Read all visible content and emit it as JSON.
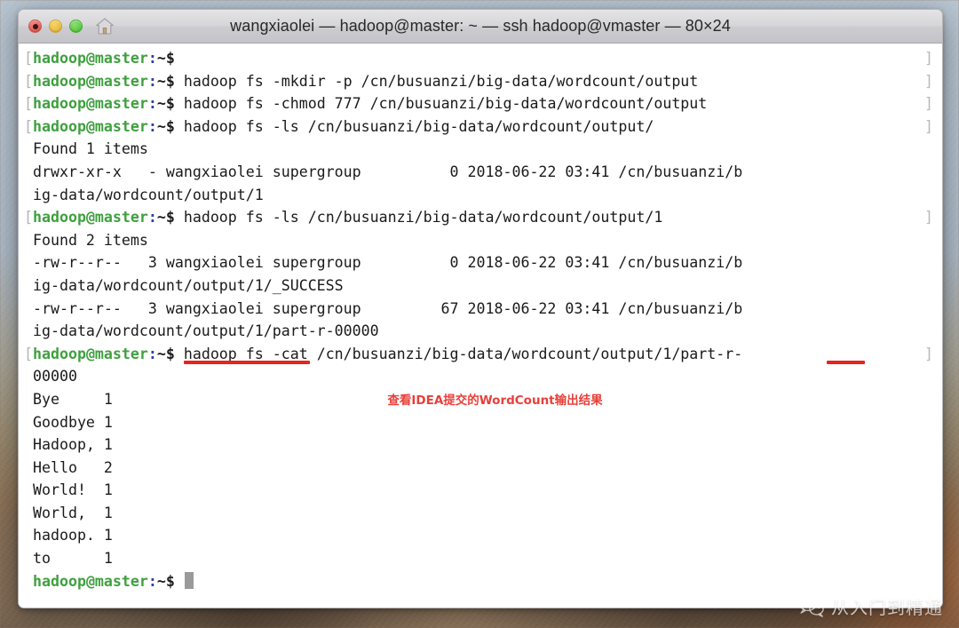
{
  "window": {
    "title": "wangxiaolei — hadoop@master: ~ — ssh hadoop@vmaster — 80×24",
    "traffic_lights": {
      "close_label": "Close",
      "minimize_label": "Minimize",
      "zoom_label": "Zoom"
    },
    "home_icon": "home-icon",
    "accent_colors": {
      "prompt_green": "#3fa03f",
      "prompt_colon_blue": "#2f3fa8",
      "annotation_red": "#e8241c",
      "wrap_bracket_gray": "#b4b4b4",
      "cursor_gray": "#9a9a9a"
    }
  },
  "terminal": {
    "prompt": {
      "open_bracket": "[",
      "user_host": "hadoop@master",
      "colon": ":",
      "path": "~$",
      "wrap_bracket": "]"
    },
    "lines": [
      {
        "type": "prompt",
        "command": "",
        "wrap": true
      },
      {
        "type": "prompt",
        "command": " hadoop fs -mkdir -p /cn/busuanzi/big-data/wordcount/output",
        "wrap": true
      },
      {
        "type": "prompt",
        "command": " hadoop fs -chmod 777 /cn/busuanzi/big-data/wordcount/output",
        "wrap": true
      },
      {
        "type": "prompt",
        "command": " hadoop fs -ls /cn/busuanzi/big-data/wordcount/output/",
        "wrap": true
      },
      {
        "type": "output",
        "text": " Found 1 items"
      },
      {
        "type": "output",
        "text": " drwxr-xr-x   - wangxiaolei supergroup          0 2018-06-22 03:41 /cn/busuanzi/b"
      },
      {
        "type": "output",
        "text": " ig-data/wordcount/output/1"
      },
      {
        "type": "prompt",
        "command": " hadoop fs -ls /cn/busuanzi/big-data/wordcount/output/1",
        "wrap": true
      },
      {
        "type": "output",
        "text": " Found 2 items"
      },
      {
        "type": "output",
        "text": " -rw-r--r--   3 wangxiaolei supergroup          0 2018-06-22 03:41 /cn/busuanzi/b"
      },
      {
        "type": "output",
        "text": " ig-data/wordcount/output/1/_SUCCESS"
      },
      {
        "type": "output",
        "text": " -rw-r--r--   3 wangxiaolei supergroup         67 2018-06-22 03:41 /cn/busuanzi/b"
      },
      {
        "type": "output",
        "text": " ig-data/wordcount/output/1/part-r-00000"
      },
      {
        "type": "prompt",
        "command": " hadoop fs -cat /cn/busuanzi/big-data/wordcount/output/1/part-r-",
        "wrap": true
      },
      {
        "type": "output",
        "text": " 00000"
      },
      {
        "type": "output",
        "text": " Bye     1"
      },
      {
        "type": "output",
        "text": " Goodbye 1"
      },
      {
        "type": "output",
        "text": " Hadoop, 1"
      },
      {
        "type": "output",
        "text": " Hello   2"
      },
      {
        "type": "output",
        "text": " World!  1"
      },
      {
        "type": "output",
        "text": " World,  1"
      },
      {
        "type": "output",
        "text": " hadoop. 1"
      },
      {
        "type": "output",
        "text": " to      1"
      },
      {
        "type": "prompt_active",
        "command": " ",
        "wrap": false
      }
    ],
    "wordcount_results": [
      {
        "word": "Bye",
        "count": "1"
      },
      {
        "word": "Goodbye",
        "count": "1"
      },
      {
        "word": "Hadoop,",
        "count": "1"
      },
      {
        "word": "Hello",
        "count": "2"
      },
      {
        "word": "World!",
        "count": "1"
      },
      {
        "word": "World,",
        "count": "1"
      },
      {
        "word": "hadoop.",
        "count": "1"
      },
      {
        "word": "to",
        "count": "1"
      }
    ]
  },
  "annotations": {
    "note_text": "查看IDEA提交的WordCount输出结果",
    "underline_left_label": "underline-cat-command",
    "underline_right_label": "underline-part-r-prefix"
  },
  "watermark": {
    "icon": "wechat-icon",
    "label": "从入门到精通"
  }
}
